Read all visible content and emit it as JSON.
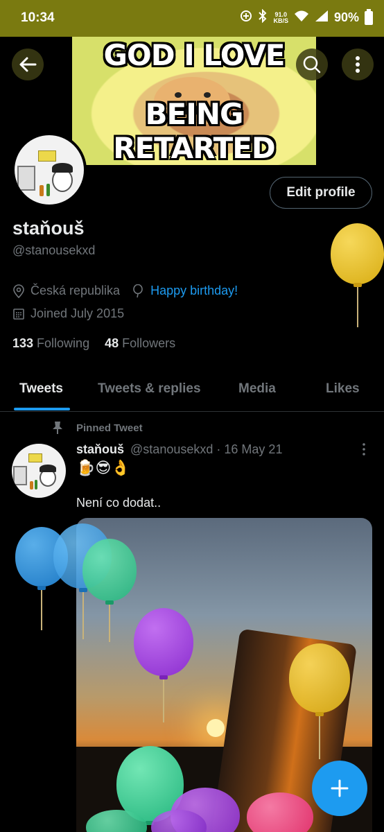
{
  "status_bar": {
    "time": "10:34",
    "net_speed_value": "91.0",
    "net_speed_unit": "KB/S",
    "battery": "90%"
  },
  "banner": {
    "top_text": "GOD I LOVE",
    "bottom_text": "BEING RETARTED"
  },
  "profile": {
    "display_name": "staňouš",
    "handle": "@stanousekxd",
    "location": "Česká republika",
    "birthday": "Happy birthday!",
    "joined": "Joined July 2015",
    "following_count": "133",
    "following_label": "Following",
    "followers_count": "48",
    "followers_label": "Followers",
    "edit_button": "Edit profile"
  },
  "tabs": [
    {
      "label": "Tweets",
      "active": true
    },
    {
      "label": "Tweets & replies",
      "active": false
    },
    {
      "label": "Media",
      "active": false
    },
    {
      "label": "Likes",
      "active": false
    }
  ],
  "tweet": {
    "pinned_label": "Pinned Tweet",
    "author_name": "staňouš",
    "author_handle": "@stanousekxd",
    "separator": "·",
    "date": "16 May 21",
    "emojis": "🍺😎👌",
    "text": "Není co dodat.."
  },
  "colors": {
    "accent": "#1d9bf0",
    "status_bar": "#7a7a10",
    "background": "#000000"
  }
}
